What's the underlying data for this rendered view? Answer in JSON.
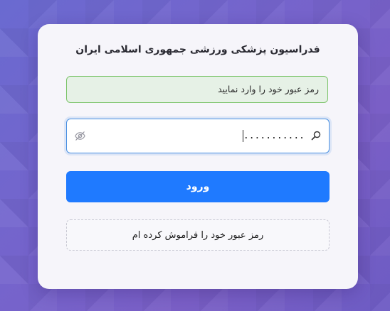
{
  "login": {
    "title": "فدراسیون پزشکی ورزشی جمهوری اسلامی ایران",
    "alert_message": "رمز عبور خود را وارد نمایید",
    "password_value": "...........",
    "login_button_label": "ورود",
    "forgot_password_label": "رمز عبور خود را فراموش کرده ام"
  },
  "icons": {
    "search": "search-icon",
    "toggle_visibility": "eye-off-icon"
  },
  "colors": {
    "primary_button": "#1f7aff",
    "alert_background": "#e6f1e6",
    "alert_border": "#7cc46a",
    "input_focus_border": "#4a90e2"
  }
}
